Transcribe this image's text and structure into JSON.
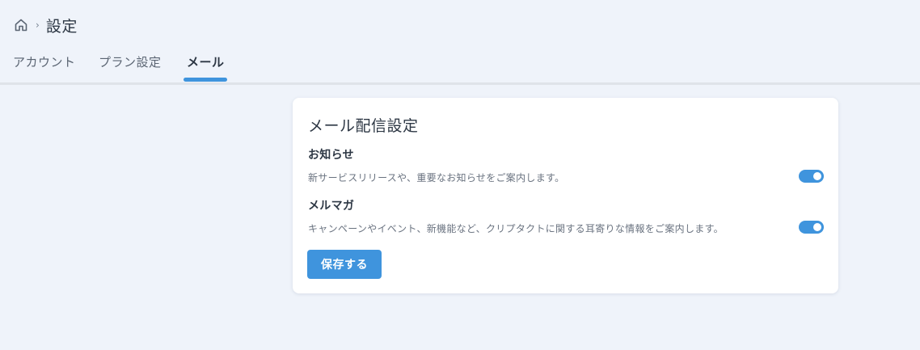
{
  "breadcrumb": {
    "separator": "›",
    "title": "設定"
  },
  "tabs": [
    {
      "label": "アカウント",
      "active": false
    },
    {
      "label": "プラン設定",
      "active": false
    },
    {
      "label": "メール",
      "active": true
    }
  ],
  "card": {
    "title": "メール配信設定",
    "settings": [
      {
        "name": "お知らせ",
        "description": "新サービスリリースや、重要なお知らせをご案内します。",
        "enabled": true
      },
      {
        "name": "メルマガ",
        "description": "キャンペーンやイベント、新機能など、クリプタクトに関する耳寄りな情報をご案内します。",
        "enabled": true
      }
    ],
    "save_label": "保存する"
  },
  "colors": {
    "accent": "#3f94dd",
    "background": "#eff3fa",
    "card": "#ffffff"
  },
  "icons": {
    "home": "home-icon"
  }
}
